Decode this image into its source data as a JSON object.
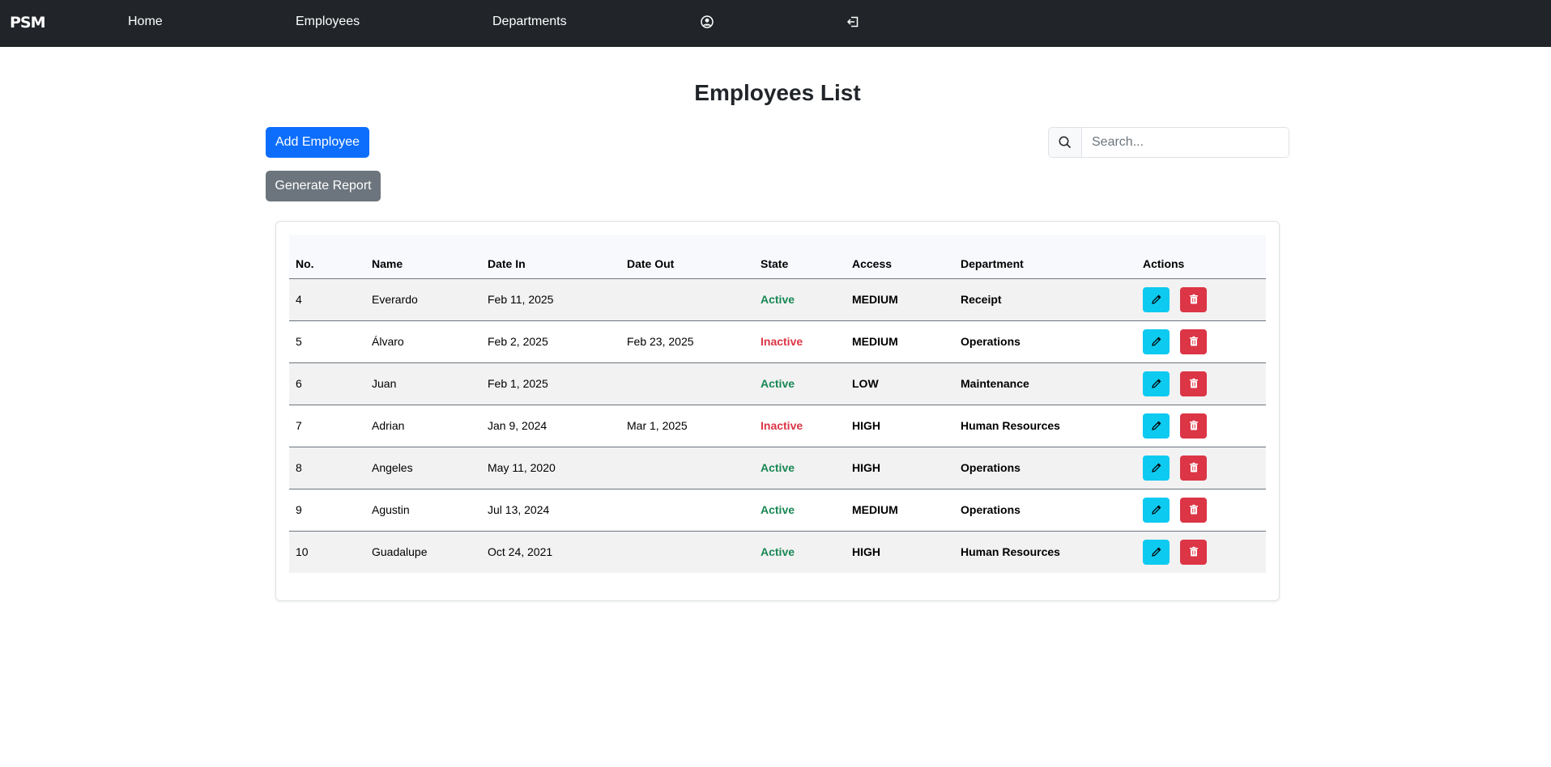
{
  "navbar": {
    "brand": "PSM",
    "links": [
      {
        "label": "Home"
      },
      {
        "label": "Employees"
      },
      {
        "label": "Departments"
      }
    ],
    "icons": [
      "user-circle-icon",
      "logout-icon"
    ]
  },
  "page": {
    "title": "Employees List",
    "add_button": "Add Employee",
    "report_button": "Generate Report",
    "search_placeholder": "Search..."
  },
  "table": {
    "headers": [
      "No.",
      "Name",
      "Date In",
      "Date Out",
      "State",
      "Access",
      "Department",
      "Actions"
    ],
    "rows": [
      {
        "no": "4",
        "name": "Everardo",
        "date_in": "Feb 11, 2025",
        "date_out": "",
        "state": "Active",
        "access": "MEDIUM",
        "department": "Receipt"
      },
      {
        "no": "5",
        "name": "Álvaro",
        "date_in": "Feb 2, 2025",
        "date_out": "Feb 23, 2025",
        "state": "Inactive",
        "access": "MEDIUM",
        "department": "Operations"
      },
      {
        "no": "6",
        "name": "Juan",
        "date_in": "Feb 1, 2025",
        "date_out": "",
        "state": "Active",
        "access": "LOW",
        "department": "Maintenance"
      },
      {
        "no": "7",
        "name": "Adrian",
        "date_in": "Jan 9, 2024",
        "date_out": "Mar 1, 2025",
        "state": "Inactive",
        "access": "HIGH",
        "department": "Human Resources"
      },
      {
        "no": "8",
        "name": "Angeles",
        "date_in": "May 11, 2020",
        "date_out": "",
        "state": "Active",
        "access": "HIGH",
        "department": "Operations"
      },
      {
        "no": "9",
        "name": "Agustin",
        "date_in": "Jul 13, 2024",
        "date_out": "",
        "state": "Active",
        "access": "MEDIUM",
        "department": "Operations"
      },
      {
        "no": "10",
        "name": "Guadalupe",
        "date_in": "Oct 24, 2021",
        "date_out": "",
        "state": "Active",
        "access": "HIGH",
        "department": "Human Resources"
      }
    ],
    "action_icons": [
      "pencil-icon",
      "trash-icon"
    ]
  },
  "colors": {
    "navbar_bg": "#212529",
    "primary": "#0d6efd",
    "secondary": "#6c757d",
    "info": "#0dcaf0",
    "danger": "#dc3545",
    "success": "#198754"
  }
}
